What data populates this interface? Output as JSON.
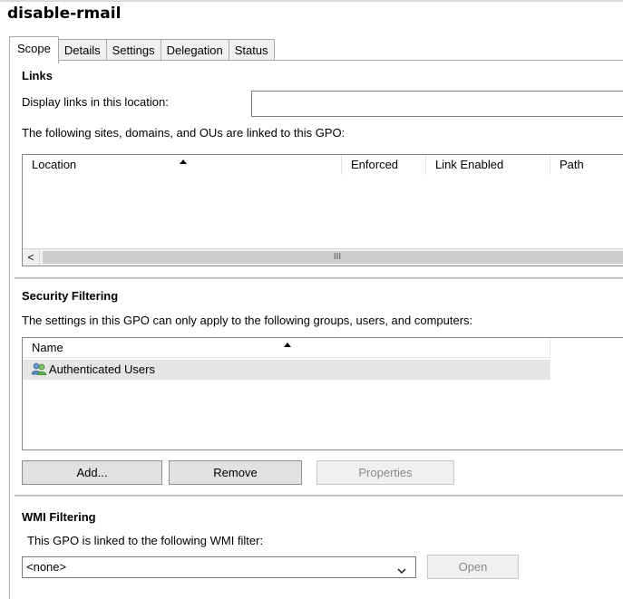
{
  "gpo_title": "disable-rmail",
  "tabs": [
    {
      "label": "Scope",
      "active": true
    },
    {
      "label": "Details",
      "active": false
    },
    {
      "label": "Settings",
      "active": false
    },
    {
      "label": "Delegation",
      "active": false
    },
    {
      "label": "Status",
      "active": false
    }
  ],
  "links": {
    "heading": "Links",
    "display_label": "Display links in this location:",
    "display_value": "",
    "list_caption": "The following sites, domains, and OUs are linked to this GPO:",
    "columns": [
      "Location",
      "Enforced",
      "Link Enabled",
      "Path"
    ],
    "scroll_left_glyph": "<",
    "scroll_thumb_glyph": "III"
  },
  "security_filtering": {
    "heading": "Security Filtering",
    "caption": "The settings in this GPO can only apply to the following groups, users, and computers:",
    "column": "Name",
    "rows": [
      {
        "name": "Authenticated Users",
        "icon": "user-group-icon"
      }
    ],
    "buttons": {
      "add": "Add...",
      "remove": "Remove",
      "properties": "Properties"
    }
  },
  "wmi_filtering": {
    "heading": "WMI Filtering",
    "caption": "This GPO is linked to the following WMI filter:",
    "selected": "<none>",
    "open_button": "Open"
  },
  "colors": {
    "selected_row": "#e5e5e5",
    "button_face": "#e1e1e1",
    "disabled_text": "#8a8a8a"
  }
}
